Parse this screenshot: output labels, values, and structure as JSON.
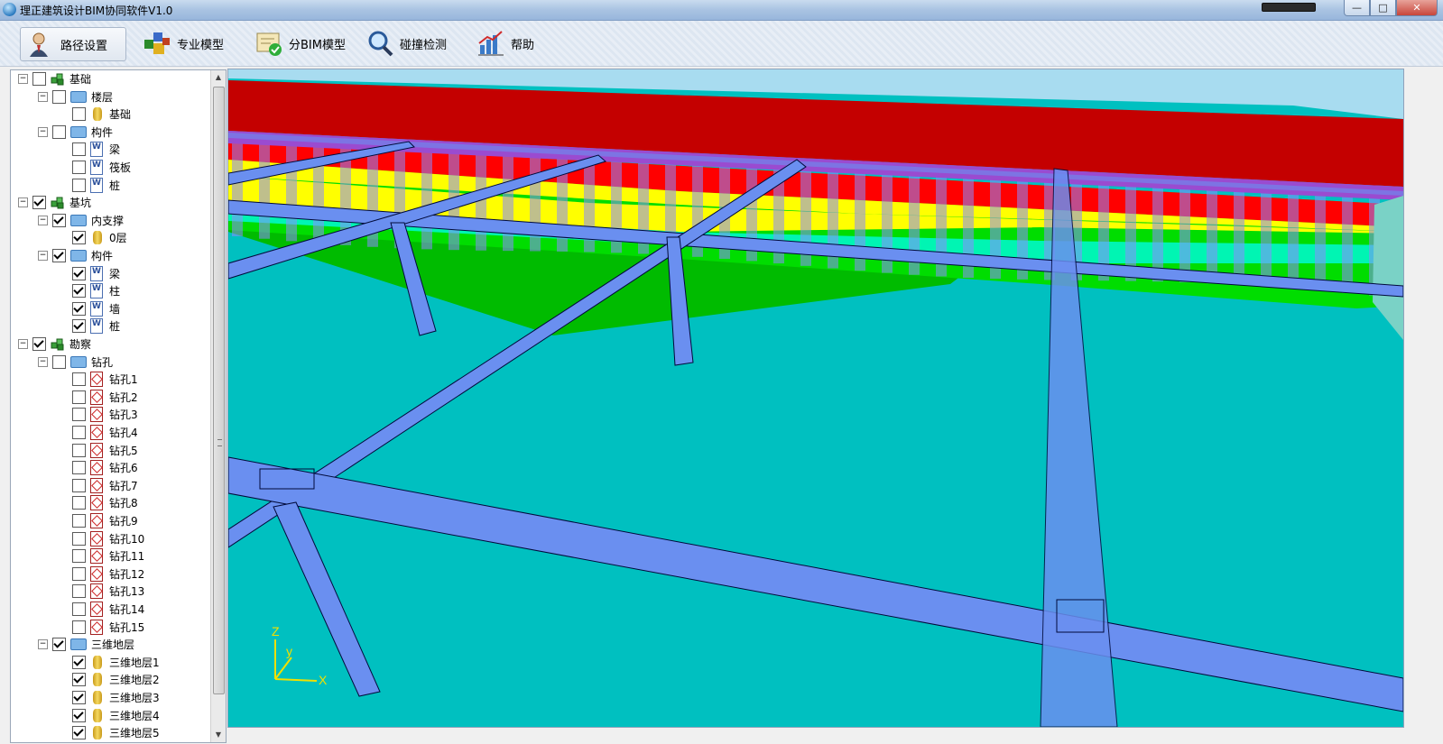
{
  "window": {
    "title": "理正建筑设计BIM协同软件V1.0",
    "controls": {
      "minimize": "—",
      "maximize": "□",
      "close": "✕"
    }
  },
  "toolbar": {
    "items": [
      {
        "label": "路径设置",
        "icon": "user-settings-icon",
        "active": true
      },
      {
        "label": "专业模型",
        "icon": "blocks-icon"
      },
      {
        "label": "分BIM模型",
        "icon": "check-document-icon"
      },
      {
        "label": "碰撞检测",
        "icon": "magnifier-icon"
      },
      {
        "label": "帮助",
        "icon": "chart-help-icon"
      }
    ]
  },
  "tree": {
    "nodes": [
      {
        "label": "基础",
        "level": 0,
        "checked": false,
        "icon": "cube-group-icon",
        "expanded": true
      },
      {
        "label": "楼层",
        "level": 1,
        "checked": false,
        "icon": "folder-icon",
        "expanded": true
      },
      {
        "label": "基础",
        "level": 2,
        "checked": false,
        "icon": "database-icon"
      },
      {
        "label": "构件",
        "level": 1,
        "checked": false,
        "icon": "folder-icon",
        "expanded": true
      },
      {
        "label": "梁",
        "level": 2,
        "checked": false,
        "icon": "word-doc-icon"
      },
      {
        "label": "筏板",
        "level": 2,
        "checked": false,
        "icon": "word-doc-icon"
      },
      {
        "label": "桩",
        "level": 2,
        "checked": false,
        "icon": "word-doc-icon"
      },
      {
        "label": "基坑",
        "level": 0,
        "checked": true,
        "icon": "cube-group-icon",
        "expanded": true
      },
      {
        "label": "内支撑",
        "level": 1,
        "checked": true,
        "icon": "folder-icon",
        "expanded": true
      },
      {
        "label": "0层",
        "level": 2,
        "checked": true,
        "icon": "database-icon"
      },
      {
        "label": "构件",
        "level": 1,
        "checked": true,
        "icon": "folder-icon",
        "expanded": true
      },
      {
        "label": "梁",
        "level": 2,
        "checked": true,
        "icon": "word-doc-icon"
      },
      {
        "label": "柱",
        "level": 2,
        "checked": true,
        "icon": "word-doc-icon"
      },
      {
        "label": "墙",
        "level": 2,
        "checked": true,
        "icon": "word-doc-icon"
      },
      {
        "label": "桩",
        "level": 2,
        "checked": true,
        "icon": "word-doc-icon"
      },
      {
        "label": "勘察",
        "level": 0,
        "checked": true,
        "icon": "cube-group-icon",
        "expanded": true
      },
      {
        "label": "钻孔",
        "level": 1,
        "checked": false,
        "icon": "folder-icon",
        "expanded": true
      },
      {
        "label": "钻孔1",
        "level": 2,
        "checked": false,
        "icon": "pdf-doc-icon"
      },
      {
        "label": "钻孔2",
        "level": 2,
        "checked": false,
        "icon": "pdf-doc-icon"
      },
      {
        "label": "钻孔3",
        "level": 2,
        "checked": false,
        "icon": "pdf-doc-icon"
      },
      {
        "label": "钻孔4",
        "level": 2,
        "checked": false,
        "icon": "pdf-doc-icon"
      },
      {
        "label": "钻孔5",
        "level": 2,
        "checked": false,
        "icon": "pdf-doc-icon"
      },
      {
        "label": "钻孔6",
        "level": 2,
        "checked": false,
        "icon": "pdf-doc-icon"
      },
      {
        "label": "钻孔7",
        "level": 2,
        "checked": false,
        "icon": "pdf-doc-icon"
      },
      {
        "label": "钻孔8",
        "level": 2,
        "checked": false,
        "icon": "pdf-doc-icon"
      },
      {
        "label": "钻孔9",
        "level": 2,
        "checked": false,
        "icon": "pdf-doc-icon"
      },
      {
        "label": "钻孔10",
        "level": 2,
        "checked": false,
        "icon": "pdf-doc-icon"
      },
      {
        "label": "钻孔11",
        "level": 2,
        "checked": false,
        "icon": "pdf-doc-icon"
      },
      {
        "label": "钻孔12",
        "level": 2,
        "checked": false,
        "icon": "pdf-doc-icon"
      },
      {
        "label": "钻孔13",
        "level": 2,
        "checked": false,
        "icon": "pdf-doc-icon"
      },
      {
        "label": "钻孔14",
        "level": 2,
        "checked": false,
        "icon": "pdf-doc-icon"
      },
      {
        "label": "钻孔15",
        "level": 2,
        "checked": false,
        "icon": "pdf-doc-icon"
      },
      {
        "label": "三维地层",
        "level": 1,
        "checked": true,
        "icon": "folder-icon",
        "expanded": true
      },
      {
        "label": "三维地层1",
        "level": 2,
        "checked": true,
        "icon": "database-icon"
      },
      {
        "label": "三维地层2",
        "level": 2,
        "checked": true,
        "icon": "database-icon"
      },
      {
        "label": "三维地层3",
        "level": 2,
        "checked": true,
        "icon": "database-icon"
      },
      {
        "label": "三维地层4",
        "level": 2,
        "checked": true,
        "icon": "database-icon"
      },
      {
        "label": "三维地层5",
        "level": 2,
        "checked": true,
        "icon": "database-icon"
      }
    ]
  },
  "viewport": {
    "axes": {
      "z": "Z",
      "y": "y",
      "x": "X"
    },
    "colors": {
      "sky": "#a8dcf0",
      "ground": "#00c0c0",
      "wall": "#c80000",
      "beam": "#6a8ff0",
      "beam_edge": "#000a3a",
      "strata": [
        "#ff0000",
        "#ffff00",
        "#00ff00",
        "#00ffff",
        "#7f7fff"
      ]
    }
  }
}
